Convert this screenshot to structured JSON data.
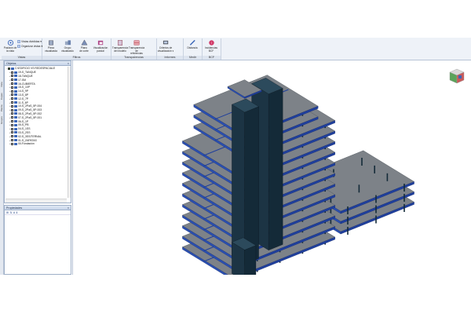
{
  "ribbon": {
    "groups": [
      {
        "label": "Vistas",
        "buttons": [
          {
            "label": "Posición de\nla vista",
            "icon": "view-position-icon"
          }
        ],
        "small": [
          {
            "label": "Vistas divididas ▾",
            "icon": "split-views-icon"
          },
          {
            "label": "Organizar vistas ▾",
            "icon": "arrange-views-icon"
          }
        ]
      },
      {
        "label": "Filtros",
        "buttons": [
          {
            "label": "Pieza\nvisualizada",
            "icon": "piece-view-icon"
          },
          {
            "label": "Grupo\nvisualizado",
            "icon": "group-view-icon"
          },
          {
            "label": "Plano\nde corte",
            "icon": "cutting-plane-icon"
          },
          {
            "label": "Visualización\nparcial",
            "icon": "partial-view-icon"
          }
        ]
      },
      {
        "label": "Transparencias",
        "buttons": [
          {
            "label": "Transparencia\ndel modelo",
            "icon": "model-transparency-icon"
          },
          {
            "label": "Transparencia de\nreferencias externas",
            "icon": "external-ref-transparency-icon"
          }
        ]
      },
      {
        "label": "Informes",
        "buttons": [
          {
            "label": "Criterios de\nvisualización ▾",
            "icon": "view-criteria-icon"
          }
        ]
      },
      {
        "label": "Medir",
        "buttons": [
          {
            "label": "Distancia",
            "icon": "ruler-icon"
          }
        ]
      },
      {
        "label": "BCF",
        "buttons": [
          {
            "label": "Incidencias\nBCF",
            "icon": "bcf-issues-icon"
          }
        ]
      }
    ]
  },
  "vtabs": [
    "Vista",
    "Capas",
    "Planta",
    "Grupos"
  ],
  "objects_panel": {
    "title": "Objetos",
    "items": [
      {
        "label": "C:\\EDIFICIO VS REDESPACIALE",
        "expanded": true,
        "checked": true,
        "level": 0
      },
      {
        "label": "19-S_TANQUE",
        "level": 1
      },
      {
        "label": "18-TANQUE",
        "level": 1
      },
      {
        "label": "17-SM",
        "level": 1
      },
      {
        "label": "16-CUBIERTA",
        "level": 1
      },
      {
        "label": "15-S_10P",
        "level": 1
      },
      {
        "label": "14-S_9P",
        "level": 1
      },
      {
        "label": "13-S_8P",
        "level": 1
      },
      {
        "label": "12-S_7P",
        "level": 1
      },
      {
        "label": "11-S_6P",
        "level": 1
      },
      {
        "label": "10-S_2PaS_5P-004",
        "level": 1
      },
      {
        "label": "09-S_2PaS_5P-003",
        "level": 1
      },
      {
        "label": "08-S_2PaS_5P-002",
        "level": 1
      },
      {
        "label": "07-S_2PaS_5P-001",
        "level": 1
      },
      {
        "label": "06-S_1P",
        "level": 1
      },
      {
        "label": "05-S_PB",
        "level": 1
      },
      {
        "label": "04-S_1SS",
        "level": 1
      },
      {
        "label": "03-S_2SS",
        "level": 1
      },
      {
        "label": "02-S_3SS/TERNAL",
        "level": 1
      },
      {
        "label": "01-S_ZAPATAS",
        "level": 1
      },
      {
        "label": "00-Fundación",
        "level": 1
      }
    ]
  },
  "properties_panel": {
    "title": "Propiedades",
    "tools": [
      "⊞",
      "⇅",
      "A",
      "ℹ"
    ]
  },
  "colors": {
    "accent": "#3b66b8",
    "structure_blue": "#1f3f9c",
    "structure_dark": "#142a38",
    "slab_gray": "#7d8288"
  }
}
